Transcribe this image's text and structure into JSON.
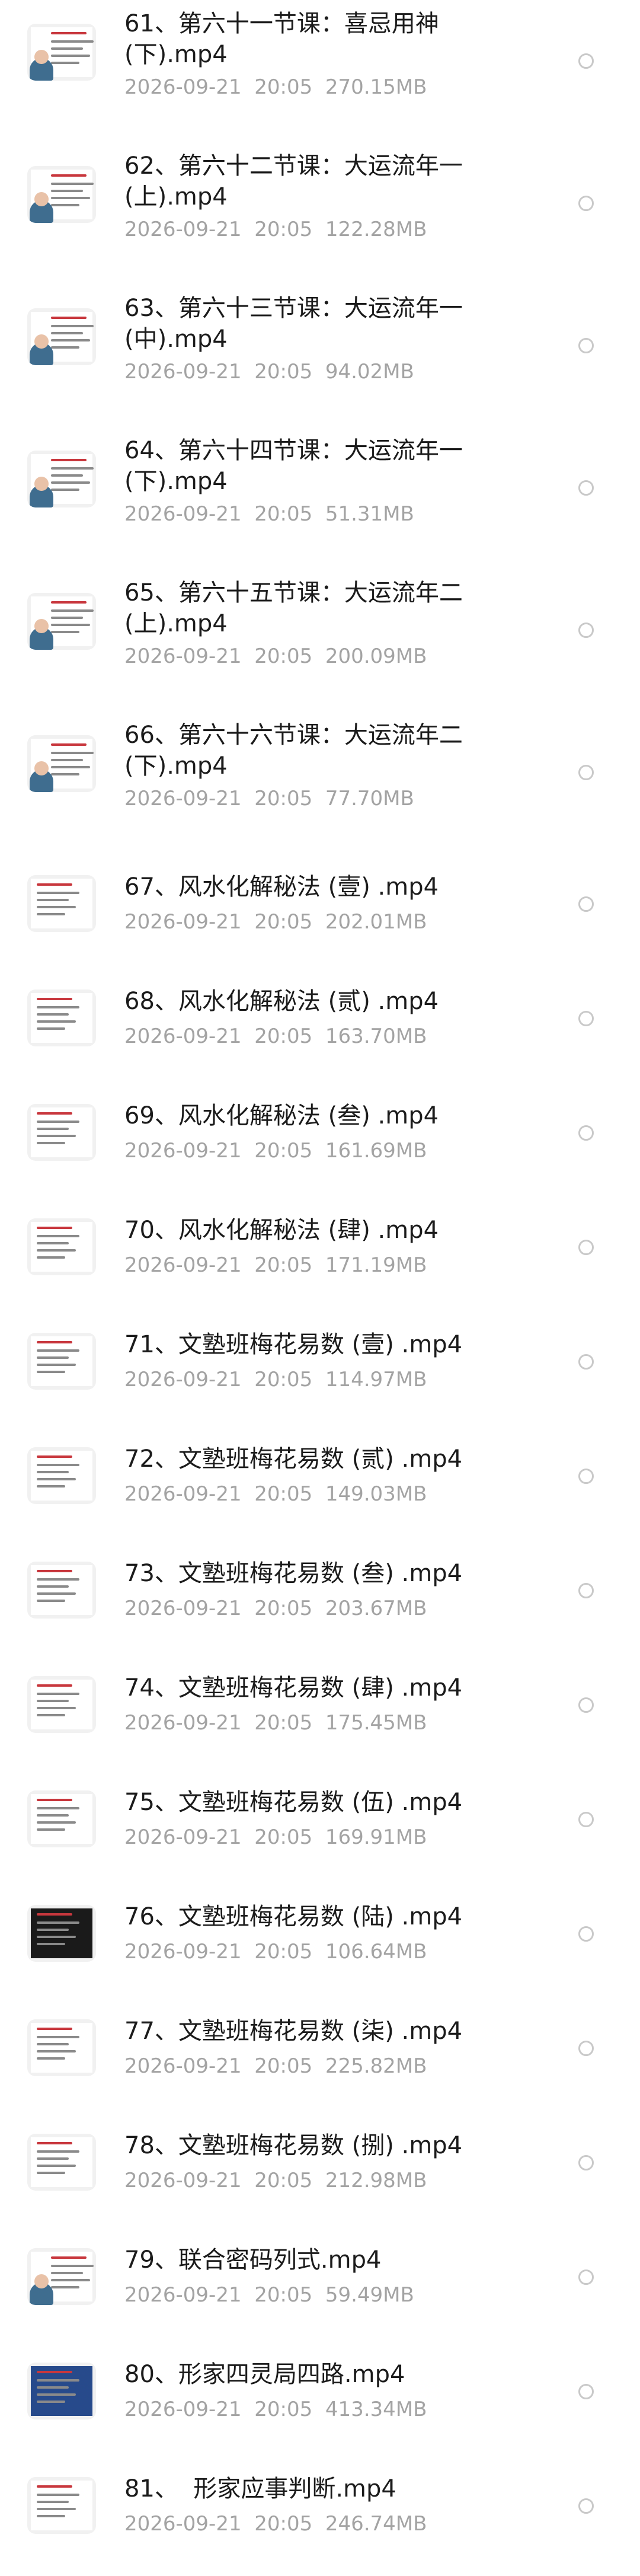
{
  "files": [
    {
      "name": "61、第六十一节课：喜忌用神\n(下).mp4",
      "date": "2026-09-21",
      "time": "20:05",
      "size": "270.15MB",
      "selected": false,
      "thumb": "slide-lecturer-thumbnail"
    },
    {
      "name": "62、第六十二节课：大运流年一\n(上).mp4",
      "date": "2026-09-21",
      "time": "20:05",
      "size": "122.28MB",
      "selected": false,
      "thumb": "slide-lecturer-thumbnail"
    },
    {
      "name": "63、第六十三节课：大运流年一\n(中).mp4",
      "date": "2026-09-21",
      "time": "20:05",
      "size": "94.02MB",
      "selected": false,
      "thumb": "slide-lecturer-thumbnail"
    },
    {
      "name": "64、第六十四节课：大运流年一\n(下).mp4",
      "date": "2026-09-21",
      "time": "20:05",
      "size": "51.31MB",
      "selected": false,
      "thumb": "slide-lecturer-thumbnail"
    },
    {
      "name": "65、第六十五节课：大运流年二\n(上).mp4",
      "date": "2026-09-21",
      "time": "20:05",
      "size": "200.09MB",
      "selected": false,
      "thumb": "slide-lecturer-thumbnail"
    },
    {
      "name": "66、第六十六节课：大运流年二\n(下).mp4",
      "date": "2026-09-21",
      "time": "20:05",
      "size": "77.70MB",
      "selected": false,
      "thumb": "slide-lecturer-thumbnail"
    },
    {
      "name": "67、风水化解秘法 (壹) .mp4",
      "date": "2026-09-21",
      "time": "20:05",
      "size": "202.01MB",
      "selected": false,
      "thumb": "slide-thumbnail"
    },
    {
      "name": "68、风水化解秘法 (贰) .mp4",
      "date": "2026-09-21",
      "time": "20:05",
      "size": "163.70MB",
      "selected": false,
      "thumb": "slide-thumbnail"
    },
    {
      "name": "69、风水化解秘法 (叁) .mp4",
      "date": "2026-09-21",
      "time": "20:05",
      "size": "161.69MB",
      "selected": false,
      "thumb": "slide-thumbnail"
    },
    {
      "name": "70、风水化解秘法 (肆) .mp4",
      "date": "2026-09-21",
      "time": "20:05",
      "size": "171.19MB",
      "selected": false,
      "thumb": "slide-thumbnail"
    },
    {
      "name": "71、文塾班梅花易数 (壹) .mp4",
      "date": "2026-09-21",
      "time": "20:05",
      "size": "114.97MB",
      "selected": false,
      "thumb": "slide-thumbnail"
    },
    {
      "name": "72、文塾班梅花易数 (贰) .mp4",
      "date": "2026-09-21",
      "time": "20:05",
      "size": "149.03MB",
      "selected": false,
      "thumb": "slide-thumbnail"
    },
    {
      "name": "73、文塾班梅花易数 (叁) .mp4",
      "date": "2026-09-21",
      "time": "20:05",
      "size": "203.67MB",
      "selected": false,
      "thumb": "slide-thumbnail"
    },
    {
      "name": "74、文塾班梅花易数 (肆) .mp4",
      "date": "2026-09-21",
      "time": "20:05",
      "size": "175.45MB",
      "selected": false,
      "thumb": "slide-thumbnail"
    },
    {
      "name": "75、文塾班梅花易数 (伍) .mp4",
      "date": "2026-09-21",
      "time": "20:05",
      "size": "169.91MB",
      "selected": false,
      "thumb": "slide-thumbnail"
    },
    {
      "name": "76、文塾班梅花易数 (陆) .mp4",
      "date": "2026-09-21",
      "time": "20:05",
      "size": "106.64MB",
      "selected": false,
      "thumb": "dark-slide-thumbnail"
    },
    {
      "name": "77、文塾班梅花易数 (柒) .mp4",
      "date": "2026-09-21",
      "time": "20:05",
      "size": "225.82MB",
      "selected": false,
      "thumb": "slide-thumbnail"
    },
    {
      "name": "78、文塾班梅花易数 (捌) .mp4",
      "date": "2026-09-21",
      "time": "20:05",
      "size": "212.98MB",
      "selected": false,
      "thumb": "slide-thumbnail"
    },
    {
      "name": "79、联合密码列式.mp4",
      "date": "2026-09-21",
      "time": "20:05",
      "size": "59.49MB",
      "selected": false,
      "thumb": "slide-lecturer-thumbnail"
    },
    {
      "name": "80、形家四灵局四路.mp4",
      "date": "2026-09-21",
      "time": "20:05",
      "size": "413.34MB",
      "selected": false,
      "thumb": "blue-slide-thumbnail"
    },
    {
      "name": "81、  形家应事判断.mp4",
      "date": "2026-09-21",
      "time": "20:05",
      "size": "246.74MB",
      "selected": false,
      "thumb": "slide-thumbnail"
    }
  ],
  "colors": {
    "name": "#1b1b1b",
    "meta": "#a3a3a3",
    "radio_border": "#c9c9c9",
    "background": "#ffffff"
  }
}
